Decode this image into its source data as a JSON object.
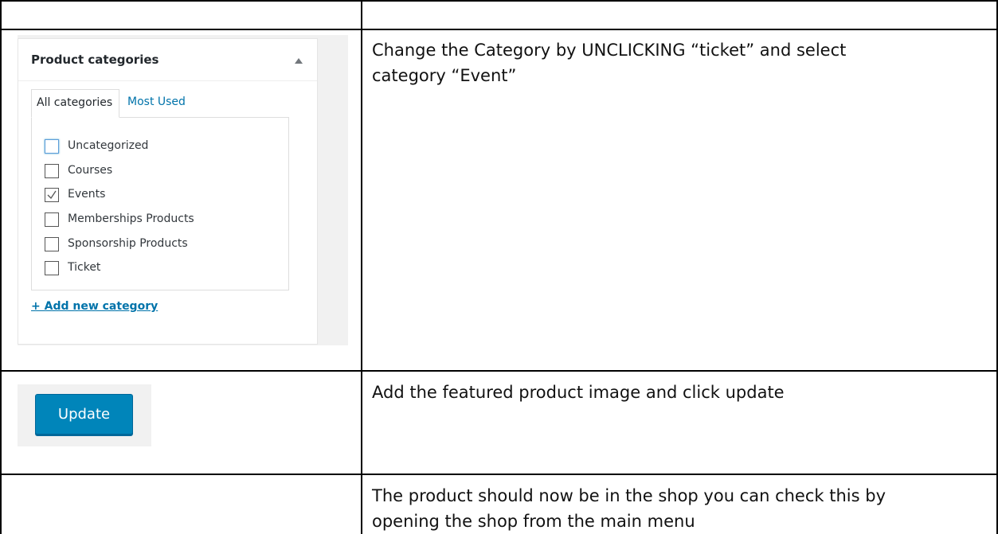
{
  "panel": {
    "title": "Product categories",
    "tabs": [
      "All categories",
      "Most Used"
    ],
    "categories": [
      {
        "label": "Uncategorized",
        "checked": false
      },
      {
        "label": "Courses",
        "checked": false
      },
      {
        "label": "Events",
        "checked": true
      },
      {
        "label": "Memberships Products",
        "checked": false
      },
      {
        "label": "Sponsorship Products",
        "checked": false
      },
      {
        "label": "Ticket",
        "checked": false
      }
    ],
    "add_link": "+ Add new category"
  },
  "update_button": {
    "label": "Update"
  },
  "instructions": {
    "row1_line1": "Change the Category by UNCLICKING “ticket” and select",
    "row1_line2": "category “Event”",
    "row2": "Add the featured product image and click update",
    "row3_line1": "The product should now be in the shop you can check this by",
    "row3_line2": "opening the shop from the main menu"
  },
  "colors": {
    "accent": "#0073aa",
    "button": "#0085ba"
  }
}
